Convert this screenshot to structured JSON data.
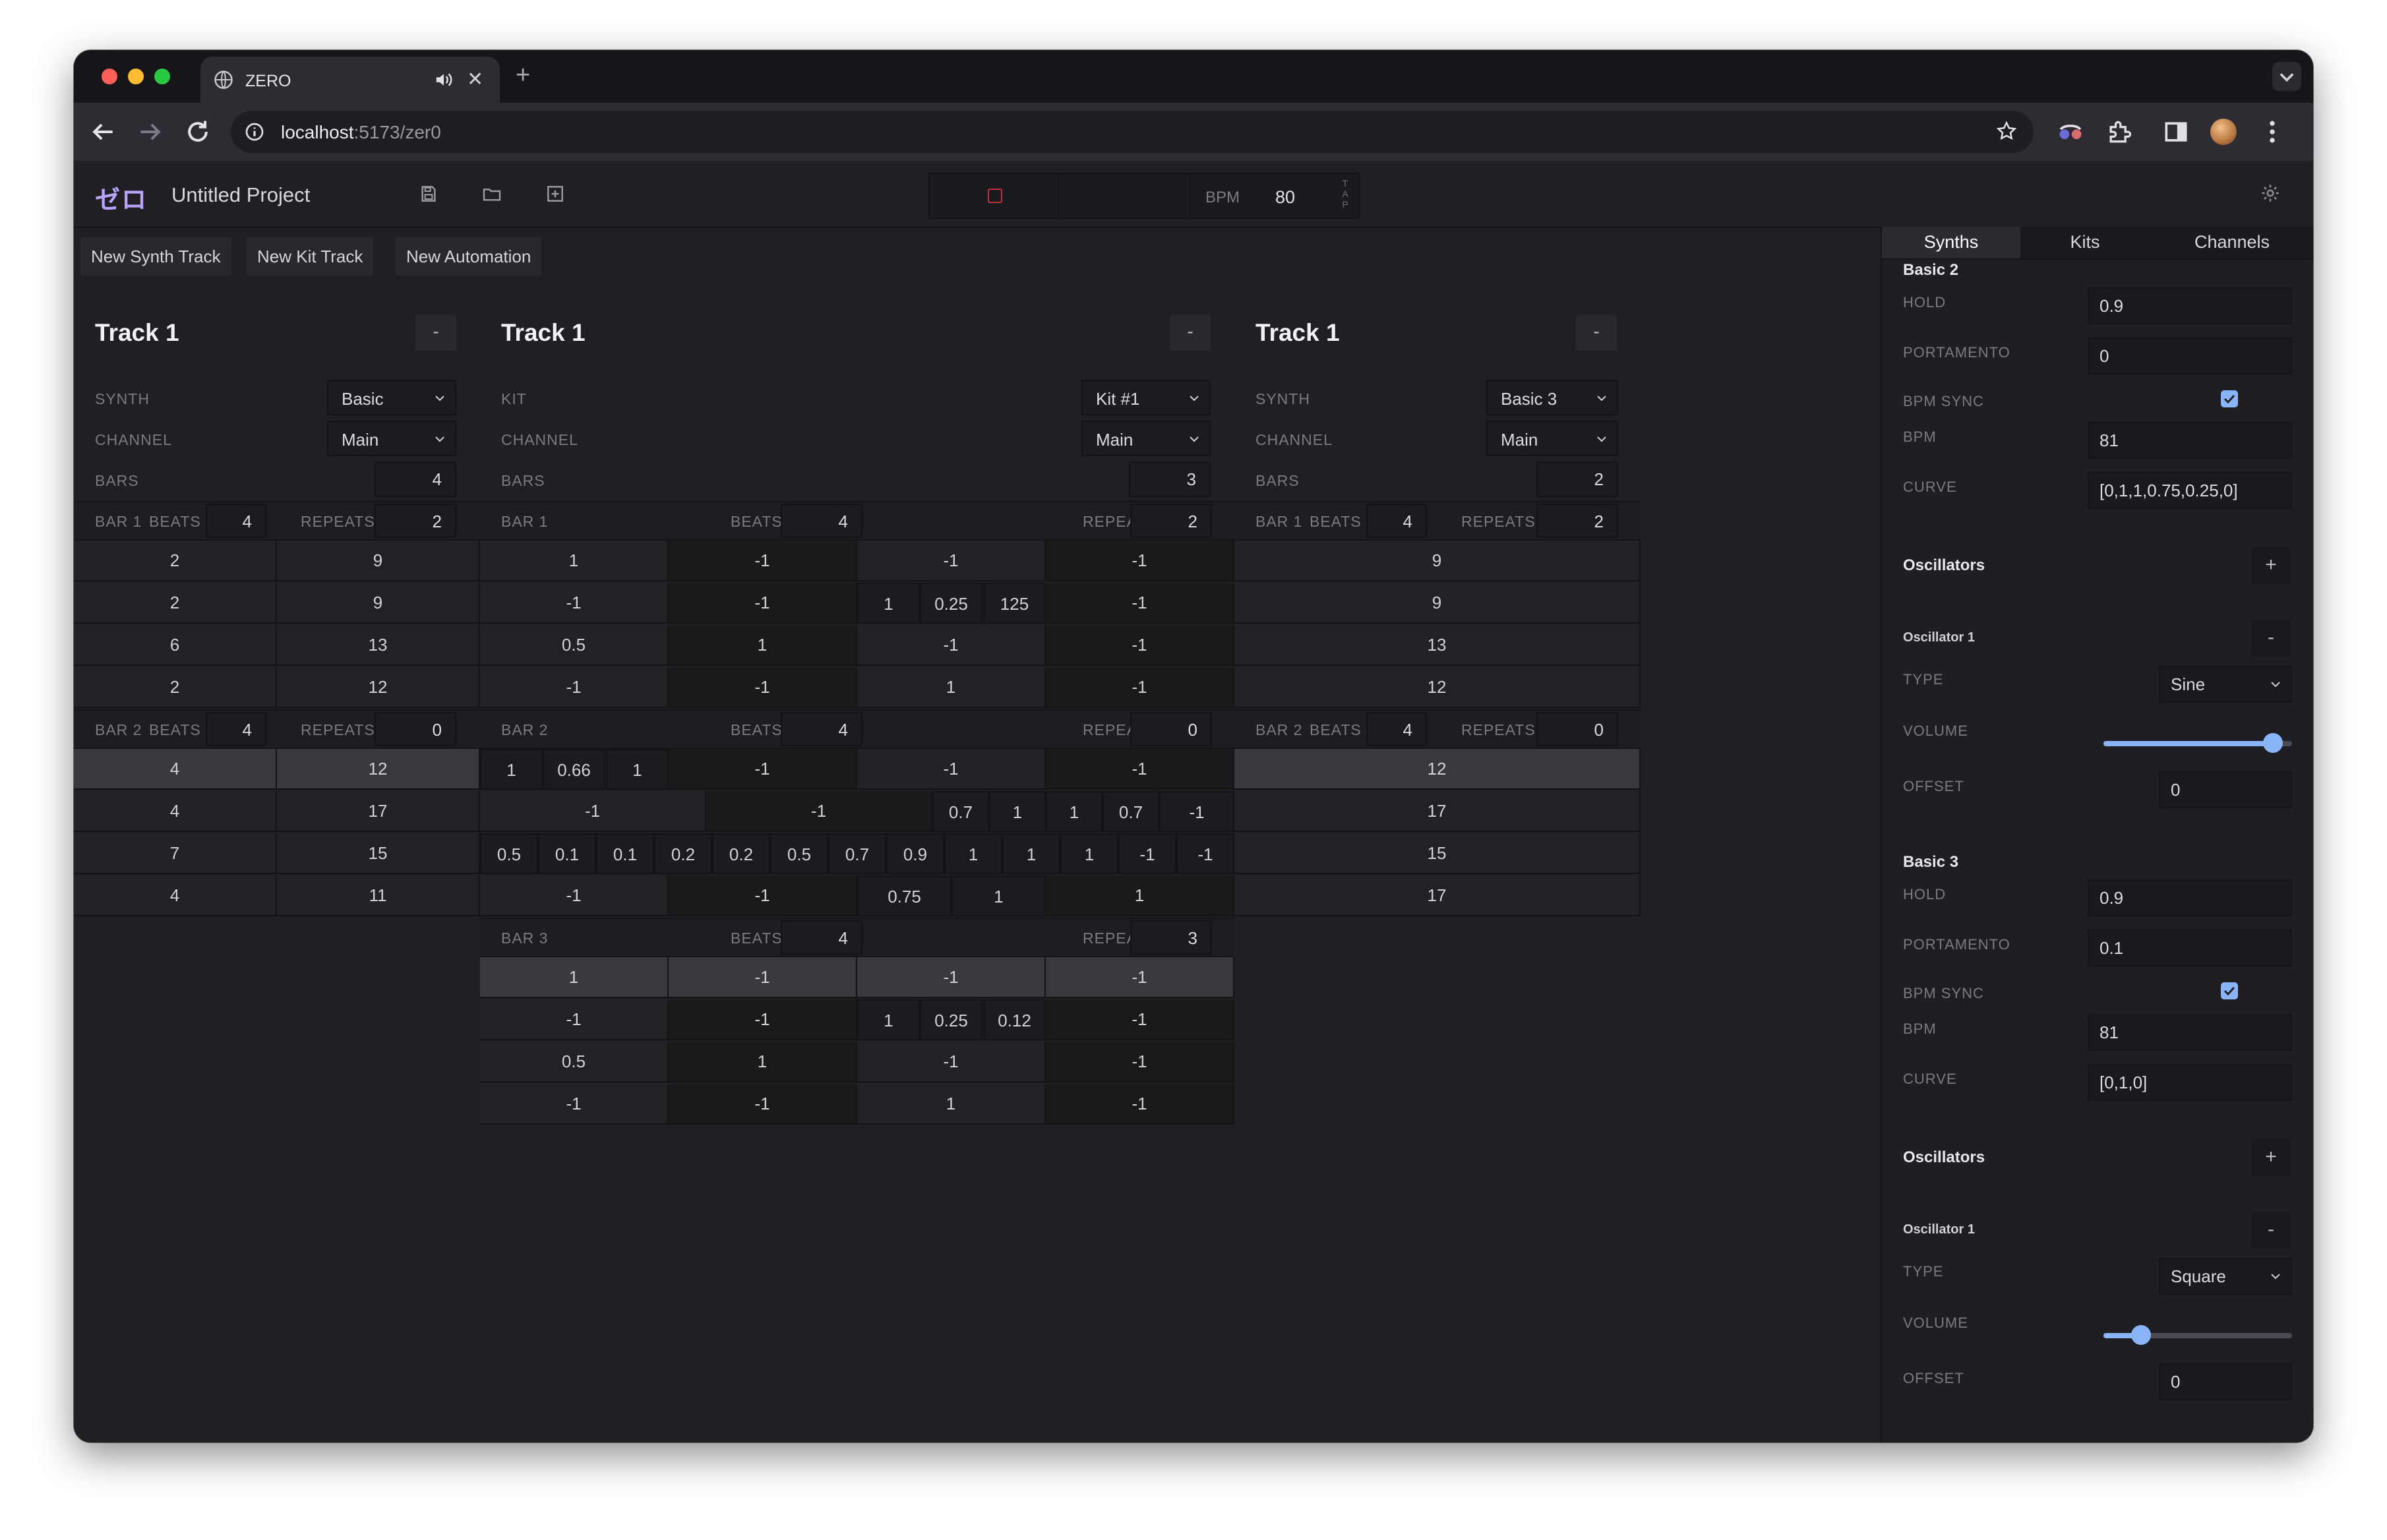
{
  "browser": {
    "tab_title": "ZERO",
    "url_host": "localhost",
    "url_rest": ":5173/zer0",
    "new_tab_label": "+",
    "close_tab_label": "✕"
  },
  "app": {
    "logo": "ゼロ",
    "project_name": "Untitled Project",
    "bpm_label": "BPM",
    "bpm_value": "80",
    "tap_label": "TAP"
  },
  "toolbar": {
    "new_synth_track": "New Synth Track",
    "new_kit_track": "New Kit Track",
    "new_automation": "New Automation"
  },
  "labels": {
    "synth": "SYNTH",
    "kit": "KIT",
    "channel": "CHANNEL",
    "bars": "BARS",
    "beats": "BEATS",
    "repeats": "REPEATS",
    "minus": "-"
  },
  "track1": {
    "title": "Track 1",
    "synth": "Basic",
    "channel": "Main",
    "bars": "4",
    "bar1": {
      "label": "BAR 1",
      "beats": "4",
      "repeats": "2",
      "rows": [
        [
          "2",
          "9"
        ],
        [
          "2",
          "9"
        ],
        [
          "6",
          "13"
        ],
        [
          "2",
          "12"
        ]
      ]
    },
    "bar2": {
      "label": "BAR 2",
      "beats": "4",
      "repeats": "0",
      "rows": [
        [
          "4",
          "12"
        ],
        [
          "4",
          "17"
        ],
        [
          "7",
          "15"
        ],
        [
          "4",
          "11"
        ]
      ]
    }
  },
  "track2": {
    "title": "Track 1",
    "kit": "Kit #1",
    "channel": "Main",
    "bars": "3",
    "bar1": {
      "label": "BAR 1",
      "beats": "4",
      "repeats": "2",
      "r0": [
        "1",
        "-1",
        "-1",
        "-1"
      ],
      "r1": [
        "-1",
        "-1",
        "1",
        "0.25",
        "125",
        "-1"
      ],
      "r2": [
        "0.5",
        "1",
        "-1",
        "-1"
      ],
      "r3": [
        "-1",
        "-1",
        "1",
        "-1"
      ]
    },
    "bar2": {
      "label": "BAR 2",
      "beats": "4",
      "repeats": "0",
      "r0": [
        "1",
        "0.66",
        "1",
        "-1",
        "-1",
        "-1"
      ],
      "r1": [
        "-1",
        "-1",
        "0.7",
        "1",
        "1",
        "0.7",
        "-1"
      ],
      "r2": [
        "0.5",
        "0.1",
        "0.1",
        "0.2",
        "0.2",
        "0.5",
        "0.7",
        "0.9",
        "1",
        "1",
        "1",
        "-1",
        "-1"
      ],
      "r3": [
        "-1",
        "-1",
        "0.75",
        "1",
        "1"
      ]
    },
    "bar3": {
      "label": "BAR 3",
      "beats": "4",
      "repeats": "3",
      "r0": [
        "1",
        "-1",
        "-1",
        "-1"
      ],
      "r1": [
        "-1",
        "-1",
        "1",
        "0.25",
        "0.12",
        "-1"
      ],
      "r2": [
        "0.5",
        "1",
        "-1",
        "-1"
      ],
      "r3": [
        "-1",
        "-1",
        "1",
        "-1"
      ]
    }
  },
  "track3": {
    "title": "Track 1",
    "synth": "Basic 3",
    "channel": "Main",
    "bars": "2",
    "bar1": {
      "label": "BAR 1",
      "beats": "4",
      "repeats": "2",
      "rows": [
        "9",
        "9",
        "13",
        "12"
      ]
    },
    "bar2": {
      "label": "BAR 2",
      "beats": "4",
      "repeats": "0",
      "rows": [
        "12",
        "17",
        "15",
        "17"
      ]
    }
  },
  "sidebar": {
    "tabs": [
      "Synths",
      "Kits",
      "Channels"
    ],
    "synths": [
      {
        "name": "Basic 2",
        "hold_label": "HOLD",
        "hold": "0.9",
        "portamento_label": "PORTAMENTO",
        "portamento": "0",
        "bpm_sync_label": "BPM SYNC",
        "bpm_sync": true,
        "bpm_label": "BPM",
        "bpm": "81",
        "curve_label": "CURVE",
        "curve": "[0,1,1,0.75,0.25,0]",
        "oscillators_label": "Oscillators",
        "add_label": "+",
        "osc": {
          "name": "Oscillator 1",
          "remove_label": "-",
          "type_label": "TYPE",
          "type": "Sine",
          "volume_label": "VOLUME",
          "volume": 0.9,
          "offset_label": "OFFSET",
          "offset": "0"
        }
      },
      {
        "name": "Basic 3",
        "hold_label": "HOLD",
        "hold": "0.9",
        "portamento_label": "PORTAMENTO",
        "portamento": "0.1",
        "bpm_sync_label": "BPM SYNC",
        "bpm_sync": true,
        "bpm_label": "BPM",
        "bpm": "81",
        "curve_label": "CURVE",
        "curve": "[0,1,0]",
        "oscillators_label": "Oscillators",
        "add_label": "+",
        "osc": {
          "name": "Oscillator 1",
          "remove_label": "-",
          "type_label": "TYPE",
          "type": "Square",
          "volume_label": "VOLUME",
          "volume": 0.2,
          "offset_label": "OFFSET",
          "offset": "0"
        }
      }
    ]
  },
  "colors": {
    "accent": "#8ab4f8",
    "logo": "#b9a3ff",
    "stop": "#c0303e",
    "loop": "#c8e26a",
    "traffic_red": "#ff5f57",
    "traffic_yellow": "#febc2e",
    "traffic_green": "#28c840"
  }
}
